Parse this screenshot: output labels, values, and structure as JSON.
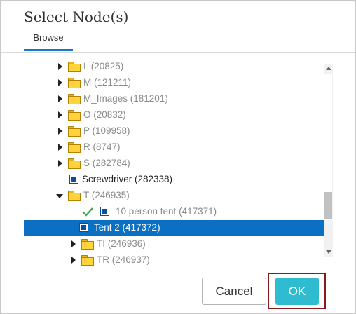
{
  "dialog": {
    "title": "Select Node(s)",
    "tab": "Browse"
  },
  "tree": {
    "rows": [
      {
        "label": "L (20825)",
        "type": "folder",
        "expander": "closed",
        "checked": false,
        "selected": false
      },
      {
        "label": "M (121211)",
        "type": "folder",
        "expander": "closed",
        "checked": false,
        "selected": false
      },
      {
        "label": "M_Images (181201)",
        "type": "folder",
        "expander": "closed",
        "checked": false,
        "selected": false
      },
      {
        "label": "O (20832)",
        "type": "folder",
        "expander": "closed",
        "checked": false,
        "selected": false
      },
      {
        "label": "P (109958)",
        "type": "folder",
        "expander": "closed",
        "checked": false,
        "selected": false
      },
      {
        "label": "R (8747)",
        "type": "folder",
        "expander": "closed",
        "checked": false,
        "selected": false
      },
      {
        "label": "S (282784)",
        "type": "folder",
        "expander": "closed",
        "checked": false,
        "selected": false
      },
      {
        "label": "Screwdriver (282338)",
        "type": "node",
        "expander": "none",
        "checked": false,
        "selected": false
      },
      {
        "label": "T (246935)",
        "type": "folder",
        "expander": "open",
        "checked": false,
        "selected": false
      },
      {
        "label": "10 person tent (417371)",
        "type": "node",
        "expander": "none",
        "checked": true,
        "selected": false
      },
      {
        "label": "Tent 2 (417372)",
        "type": "node",
        "expander": "none",
        "checked": false,
        "selected": true
      },
      {
        "label": "TI (246936)",
        "type": "folder",
        "expander": "closed",
        "checked": false,
        "selected": false
      },
      {
        "label": "TR (246937)",
        "type": "folder",
        "expander": "closed",
        "checked": false,
        "selected": false
      }
    ]
  },
  "buttons": {
    "cancel": "Cancel",
    "ok": "OK"
  },
  "colors": {
    "selection": "#0b70c2",
    "ok_button": "#2fbcd0",
    "tab_underline": "#1a75c2",
    "check": "#3aa64a",
    "highlight_frame": "#8b1a1a"
  },
  "icons": {
    "folder": "folder-icon",
    "node": "node-icon",
    "check": "check-icon"
  }
}
